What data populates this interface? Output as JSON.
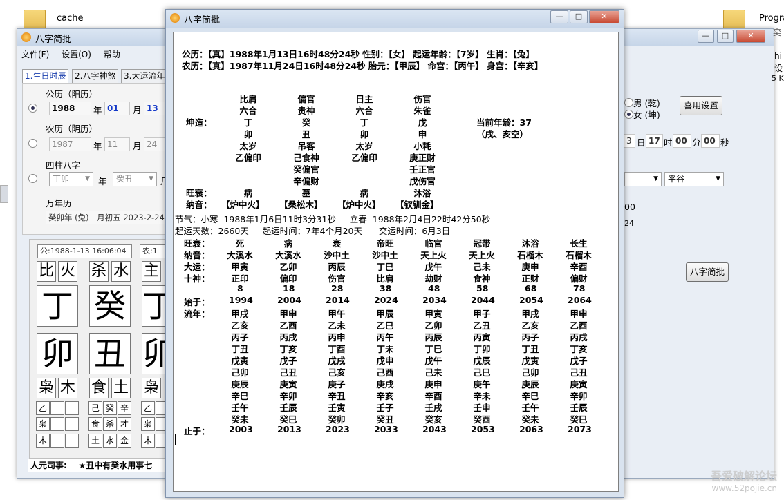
{
  "desktop": {
    "icons": [
      {
        "label": "cache"
      },
      {
        "label": "Progra"
      }
    ]
  },
  "back_window": {
    "title": "八字简批",
    "menu": [
      "文件(F)",
      "设置(O)",
      "帮助"
    ],
    "tabs": [
      "1.生日时辰",
      "2.八字神煞",
      "3.大运流年"
    ],
    "solar_label": "公历（阳历）",
    "solar": {
      "year": "1988",
      "year_unit": "年",
      "month": "01",
      "month_unit": "月",
      "day": "13"
    },
    "lunar_label": "农历（阴历）",
    "lunar": {
      "year": "1987",
      "year_unit": "年",
      "month": "11",
      "month_unit": "月",
      "day": "24"
    },
    "pillars_label": "四柱八字",
    "pillars": {
      "year": "丁卯",
      "year_unit": "年",
      "month": "癸丑",
      "month_unit": "月"
    },
    "wannianli_label": "万年历",
    "wannianli_value": "癸卯年 (兔)二月初五  2023-2-24",
    "gender_label_male": "男 (乾)",
    "gender_label_female": "女 (坤)",
    "common_settings_button": "喜用设置",
    "time": {
      "day": "17",
      "day_unit": "日",
      "hour": "00",
      "hour_unit": "时",
      "minute": "00",
      "minute_unit": "分",
      "second_unit": "秒"
    },
    "time_partial_left": "3",
    "combo_left": "",
    "combo_right": "平谷",
    "partial_text_1": "00",
    "partial_text_2": "24",
    "bazi_button": "八字简批",
    "side_partial": [
      "hi",
      "设",
      "5 K",
      "奕"
    ],
    "info_solar": "公:1988-1-13 16:06:04",
    "info_lunar": "农:1",
    "god_row1": [
      "比",
      "火",
      "杀",
      "水",
      "主"
    ],
    "stems": [
      "丁",
      "癸",
      "丁"
    ],
    "branches": [
      "卯",
      "丑",
      "卯"
    ],
    "god_row2": [
      "枭",
      "木",
      "食",
      "土",
      "枭"
    ],
    "small_rows": [
      [
        "乙",
        "",
        "",
        "己",
        "癸",
        "辛",
        "乙",
        ""
      ],
      [
        "枭",
        "",
        "",
        "食",
        "杀",
        "才",
        "枭",
        ""
      ],
      [
        "木",
        "",
        "",
        "土",
        "水",
        "金",
        "木",
        ""
      ]
    ],
    "bottom_text": "人元司事:    ★丑中有癸水用事七"
  },
  "front_window": {
    "title": "八字简批",
    "header_line1": "公历：【真】1988年1月13日16时48分24秒  性别：【女】  起运年龄：【7岁】  生肖：【兔】",
    "header_line2": "农历：【真】1987年11月24日16时48分24秒  胎元：【甲辰】  命宫：【丙午】  身宫：【辛亥】",
    "chart": {
      "label_kunzao": "坤造：",
      "label_wangshuai": "旺衰：",
      "label_nayin": "纳音：",
      "columns": [
        {
          "top1": "比肩",
          "top2": "六合",
          "stem": "丁",
          "branch": "卯",
          "extra1": "太岁",
          "hidden": [
            "乙偏印"
          ],
          "wangshuai": "病",
          "nayin": "【炉中火】"
        },
        {
          "top1": "偏官",
          "top2": "贵神",
          "stem": "癸",
          "branch": "丑",
          "extra1": "吊客",
          "hidden": [
            "己食神",
            "癸偏官",
            "辛偏财"
          ],
          "wangshuai": "墓",
          "nayin": "【桑松木】"
        },
        {
          "top1": "日主",
          "top2": "六合",
          "stem": "丁",
          "branch": "卯",
          "extra1": "太岁",
          "hidden": [
            "乙偏印"
          ],
          "wangshuai": "病",
          "nayin": "【炉中火】"
        },
        {
          "top1": "伤官",
          "top2": "朱雀",
          "stem": "戊",
          "branch": "申",
          "extra1": "小耗",
          "hidden": [
            "庚正财",
            "壬正官",
            "戊伤官"
          ],
          "wangshuai": "沐浴",
          "nayin": "【钗钏金】"
        }
      ],
      "current_age": "当前年龄：37",
      "kongwang": "（戌、亥空）"
    },
    "jieqi_line": "节气：小寒  1988年1月6日11时3分31秒     立春  1988年2月4日22时42分50秒",
    "qiyun_line": "起运天数：2660天     起运时间：7年4个月20天      交运时间：6月3日",
    "dayun": {
      "row_labels": [
        "旺衰：",
        "纳音：",
        "大运：",
        "十神："
      ],
      "start_label": "始于：",
      "liunian_label": "流年：",
      "end_label": "止于：",
      "columns": [
        {
          "wangshuai": "死",
          "nayin": "大溪水",
          "dayun": "甲寅",
          "shishen": "正印",
          "age": "8",
          "start": "1994",
          "liunian": [
            "甲戌",
            "乙亥",
            "丙子",
            "丁丑",
            "戊寅",
            "己卯",
            "庚辰",
            "辛巳",
            "壬午",
            "癸未"
          ],
          "end": "2003"
        },
        {
          "wangshuai": "病",
          "nayin": "大溪水",
          "dayun": "乙卯",
          "shishen": "偏印",
          "age": "18",
          "start": "2004",
          "liunian": [
            "甲申",
            "乙酉",
            "丙戌",
            "丁亥",
            "戊子",
            "己丑",
            "庚寅",
            "辛卯",
            "壬辰",
            "癸巳"
          ],
          "end": "2013"
        },
        {
          "wangshuai": "衰",
          "nayin": "沙中土",
          "dayun": "丙辰",
          "shishen": "伤官",
          "age": "28",
          "start": "2014",
          "liunian": [
            "甲午",
            "乙未",
            "丙申",
            "丁酉",
            "戊戌",
            "己亥",
            "庚子",
            "辛丑",
            "壬寅",
            "癸卯"
          ],
          "end": "2023"
        },
        {
          "wangshuai": "帝旺",
          "nayin": "沙中土",
          "dayun": "丁巳",
          "shishen": "比肩",
          "age": "38",
          "start": "2024",
          "liunian": [
            "甲辰",
            "乙巳",
            "丙午",
            "丁未",
            "戊申",
            "己酉",
            "庚戌",
            "辛亥",
            "壬子",
            "癸丑"
          ],
          "end": "2033"
        },
        {
          "wangshuai": "临官",
          "nayin": "天上火",
          "dayun": "戊午",
          "shishen": "劫财",
          "age": "48",
          "start": "2034",
          "liunian": [
            "甲寅",
            "乙卯",
            "丙辰",
            "丁巳",
            "戊午",
            "己未",
            "庚申",
            "辛酉",
            "壬戌",
            "癸亥"
          ],
          "end": "2043"
        },
        {
          "wangshuai": "冠带",
          "nayin": "天上火",
          "dayun": "己未",
          "shishen": "食神",
          "age": "58",
          "start": "2044",
          "liunian": [
            "甲子",
            "乙丑",
            "丙寅",
            "丁卯",
            "戊辰",
            "己巳",
            "庚午",
            "辛未",
            "壬申",
            "癸酉"
          ],
          "end": "2053"
        },
        {
          "wangshuai": "沐浴",
          "nayin": "石榴木",
          "dayun": "庚申",
          "shishen": "正财",
          "age": "68",
          "start": "2054",
          "liunian": [
            "甲戌",
            "乙亥",
            "丙子",
            "丁丑",
            "戊寅",
            "己卯",
            "庚辰",
            "辛巳",
            "壬午",
            "癸未"
          ],
          "end": "2063"
        },
        {
          "wangshuai": "长生",
          "nayin": "石榴木",
          "dayun": "辛酉",
          "shishen": "偏财",
          "age": "78",
          "start": "2064",
          "liunian": [
            "甲申",
            "乙酉",
            "丙戌",
            "丁亥",
            "戊子",
            "己丑",
            "庚寅",
            "辛卯",
            "壬辰",
            "癸巳"
          ],
          "end": "2073"
        }
      ]
    }
  },
  "watermark": {
    "line1": "吾爱破解论坛",
    "line2": "www.52pojie.cn"
  }
}
